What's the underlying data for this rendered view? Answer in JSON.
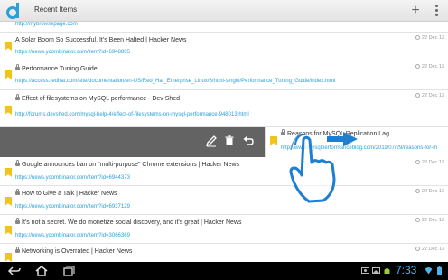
{
  "header": {
    "title": "Recent Items",
    "add_label": "+"
  },
  "items": [
    {
      "title": "",
      "url": "http://mybrowsepage.com",
      "date": "",
      "locked": false
    },
    {
      "title": "A Solar Boom So Successful, It's Been Halted | Hacker News",
      "url": "https://news.ycombinator.com/item?id=6948805",
      "date": "22 Dec 13",
      "locked": false
    },
    {
      "title": "Performance Tuning Guide",
      "url": "https://access.redhat.com/site/documentation/en-US/Red_Hat_Enterprise_Linux/6/html-single/Performance_Tuning_Guide/index.html",
      "date": "22 Dec 13",
      "locked": true
    },
    {
      "title": "Effect of filesystems on MySQL performance - Dev Shed",
      "url": "http://forums.devshed.com/mysql-help-4/effect-of-filesystems-on-mysql-performance-948013.html",
      "date": "22 Dec 13",
      "locked": true
    },
    {
      "title": "Reasons for MySQL Replication Lag",
      "url": "http://www.mysqlperformanceblog.com/2011/07/29/reasons-for-m",
      "date": "22 Dec 13",
      "locked": true
    },
    {
      "title": "Google announces ban on \"multi-purpose\" Chrome extensions | Hacker News",
      "url": "https://news.ycombinator.com/item?id=6944373",
      "date": "22 Dec 13",
      "locked": true
    },
    {
      "title": "How to Give a Talk | Hacker News",
      "url": "https://news.ycombinator.com/item?id=6937129",
      "date": "22 Dec 13",
      "locked": true
    },
    {
      "title": "It's not a secret. We do monetize social discovery, and it's great | Hacker News",
      "url": "https://news.ycombinator.com/item?id=3066369",
      "date": "22 Dec 13",
      "locked": true
    },
    {
      "title": "Networking is Overrated | Hacker News",
      "url": "https://news.ycombinator.com/item?id=...",
      "date": "22 Dec 13",
      "locked": true
    }
  ],
  "swipe_actions": {
    "icons": [
      "edit-icon",
      "trash-icon",
      "undo-icon"
    ]
  },
  "status_bar": {
    "time": "7:33"
  },
  "colors": {
    "accent": "#2aa0d9",
    "bookmark": "#f2c318",
    "swipe_bg": "#636363"
  }
}
